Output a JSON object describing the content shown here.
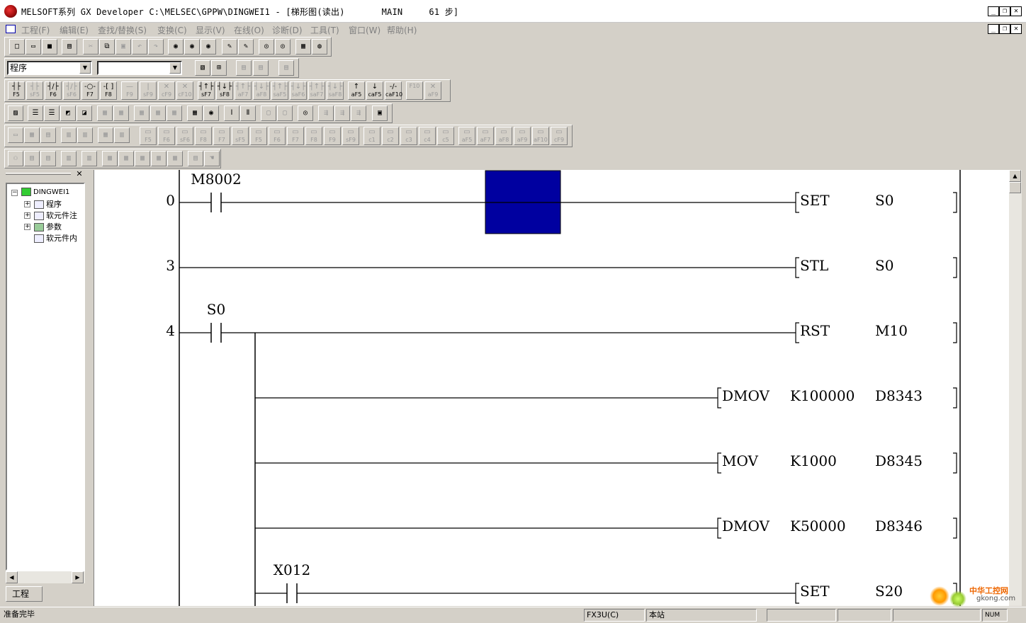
{
  "window": {
    "title": "MELSOFT系列 GX Developer C:\\MELSEC\\GPPW\\DINGWEI1 - [梯形图(读出)       MAIN     61 步]",
    "min": "_",
    "restore": "❐",
    "close": "✕"
  },
  "menu": [
    "工程(F)",
    "编辑(E)",
    "查找/替换(S)",
    "变换(C)",
    "显示(V)",
    "在线(O)",
    "诊断(D)",
    "工具(T)",
    "窗口(W)",
    "帮助(H)"
  ],
  "combo1": {
    "value": "程序"
  },
  "combo2": {
    "value": ""
  },
  "fkeys": [
    {
      "g": "┤├",
      "k": "F5"
    },
    {
      "g": "┤├",
      "k": "sF5"
    },
    {
      "g": "┤/├",
      "k": "F6"
    },
    {
      "g": "┤/├",
      "k": "sF6"
    },
    {
      "g": "-○-",
      "k": "F7"
    },
    {
      "g": "-[ ]",
      "k": "F8"
    },
    {
      "g": "—",
      "k": "F9"
    },
    {
      "g": "|",
      "k": "sF9"
    },
    {
      "g": "✕",
      "k": "cF9"
    },
    {
      "g": "✕",
      "k": "cF10"
    },
    {
      "g": "┤↑├",
      "k": "sF7"
    },
    {
      "g": "┤↓├",
      "k": "sF8"
    },
    {
      "g": "┤↑├",
      "k": "aF7"
    },
    {
      "g": "┤↓├",
      "k": "aF8"
    },
    {
      "g": "┤↑├",
      "k": "saF5"
    },
    {
      "g": "┤↓├",
      "k": "saF6"
    },
    {
      "g": "┤↑├",
      "k": "saF7"
    },
    {
      "g": "┤↓├",
      "k": "saF8"
    },
    {
      "g": "↑",
      "k": "aF5"
    },
    {
      "g": "↓",
      "k": "caF5"
    },
    {
      "g": "-/-",
      "k": "caF10"
    },
    {
      "g": "",
      "k": "F10"
    },
    {
      "g": "✕",
      "k": "aF9"
    }
  ],
  "fkeys2": [
    {
      "k": "F5"
    },
    {
      "k": "F6"
    },
    {
      "k": "sF6"
    },
    {
      "k": "F8"
    },
    {
      "k": "F7"
    },
    {
      "k": "sF5"
    },
    {
      "k": "F5"
    },
    {
      "k": "F6"
    },
    {
      "k": "F7"
    },
    {
      "k": "F8"
    },
    {
      "k": "F9"
    },
    {
      "k": "sF9"
    },
    {
      "k": "c1"
    },
    {
      "k": "c2"
    },
    {
      "k": "c3"
    },
    {
      "k": "c4"
    },
    {
      "k": "c5"
    },
    {
      "k": "aF5"
    },
    {
      "k": "aF7"
    },
    {
      "k": "aF8"
    },
    {
      "k": "aF9"
    },
    {
      "k": "aF10"
    },
    {
      "k": "cF9"
    }
  ],
  "tree": {
    "root": "DINGWEI1",
    "items": [
      "程序",
      "软元件注",
      "参数",
      "软元件内"
    ]
  },
  "tab": "工程",
  "ladder": {
    "rungs": [
      {
        "step": "0",
        "contact": "M8002",
        "instr": "SET",
        "op1": "S0",
        "op2": ""
      },
      {
        "step": "3",
        "contact": "",
        "instr": "STL",
        "op1": "S0",
        "op2": ""
      },
      {
        "step": "4",
        "contact": "S0",
        "instr": "RST",
        "op1": "M10",
        "op2": ""
      },
      {
        "step": "",
        "contact": "",
        "instr": "DMOV",
        "op1": "K100000",
        "op2": "D8343"
      },
      {
        "step": "",
        "contact": "",
        "instr": "MOV",
        "op1": "K1000",
        "op2": "D8345"
      },
      {
        "step": "",
        "contact": "",
        "instr": "DMOV",
        "op1": "K50000",
        "op2": "D8346"
      },
      {
        "step": "",
        "contact": "X012",
        "instr": "SET",
        "op1": "S20",
        "op2": ""
      }
    ],
    "cursor_color": "#0000a0"
  },
  "watermark": {
    "title": "中华工控网",
    "url": "gkong.com"
  },
  "status": {
    "ready": "准备完毕",
    "cpu": "FX3U(C)",
    "station": "本站",
    "mode": "NUM"
  }
}
